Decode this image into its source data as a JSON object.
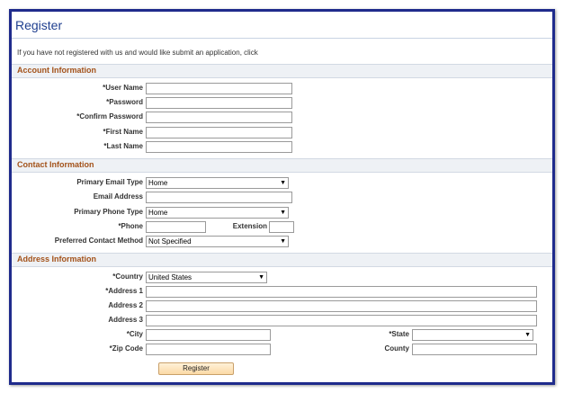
{
  "title": "Register",
  "intro": "If you have not registered with us and would like submit an application, click",
  "account": {
    "heading": "Account Information",
    "user_name": "*User Name",
    "password": "*Password",
    "confirm_password": "*Confirm Password",
    "first_name": "*First Name",
    "last_name": "*Last Name"
  },
  "contact": {
    "heading": "Contact Information",
    "primary_email_type": "Primary Email Type",
    "primary_email_type_value": "Home",
    "email_address": "Email Address",
    "primary_phone_type": "Primary Phone Type",
    "primary_phone_type_value": "Home",
    "phone": "*Phone",
    "extension": "Extension",
    "preferred_contact_method": "Preferred Contact Method",
    "preferred_contact_method_value": "Not Specified"
  },
  "address": {
    "heading": "Address Information",
    "country": "*Country",
    "country_value": "United States",
    "address1": "*Address 1",
    "address2": "Address 2",
    "address3": "Address 3",
    "city": "*City",
    "state": "*State",
    "state_value": "",
    "zip": "*Zip Code",
    "county": "County"
  },
  "register_button": "Register",
  "colors": {
    "border": "#1f2b8c",
    "title": "#1f3f8f",
    "section_heading": "#a3521a",
    "button": "#fbd9a6"
  }
}
